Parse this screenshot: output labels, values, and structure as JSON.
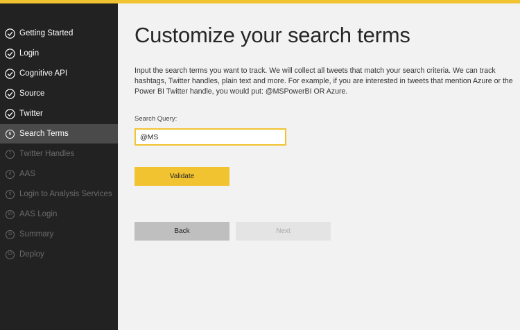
{
  "sidebar": {
    "items": [
      {
        "label": "Getting Started",
        "state": "done",
        "icon": "checkmark-icon"
      },
      {
        "label": "Login",
        "state": "done",
        "icon": "checkmark-icon"
      },
      {
        "label": "Cognitive API",
        "state": "done",
        "icon": "checkmark-icon"
      },
      {
        "label": "Source",
        "state": "done",
        "icon": "checkmark-icon"
      },
      {
        "label": "Twitter",
        "state": "done",
        "icon": "checkmark-icon"
      },
      {
        "label": "Search Terms",
        "state": "active",
        "number": "6"
      },
      {
        "label": "Twitter Handles",
        "state": "future",
        "number": "7"
      },
      {
        "label": "AAS",
        "state": "future",
        "number": "8"
      },
      {
        "label": "Login to Analysis Services",
        "state": "future",
        "number": "9"
      },
      {
        "label": "AAS Login",
        "state": "future",
        "number": "10"
      },
      {
        "label": "Summary",
        "state": "future",
        "number": "11"
      },
      {
        "label": "Deploy",
        "state": "future",
        "number": "12"
      }
    ]
  },
  "main": {
    "title": "Customize your search terms",
    "description": "Input the search terms you want to track. We will collect all tweets that match your search criteria. We can track hashtags, Twitter handles, plain text and more. For example, if you are interested in tweets that mention Azure or the Power BI Twitter handle, you would put: @MSPowerBI OR Azure.",
    "search_label": "Search Query:",
    "search_value": "@MS",
    "validate_label": "Validate",
    "back_label": "Back",
    "next_label": "Next"
  },
  "colors": {
    "accent": "#f2c330",
    "sidebar_bg": "#222222",
    "sidebar_active_bg": "#4a4a4a",
    "content_bg": "#f2f2f2"
  }
}
